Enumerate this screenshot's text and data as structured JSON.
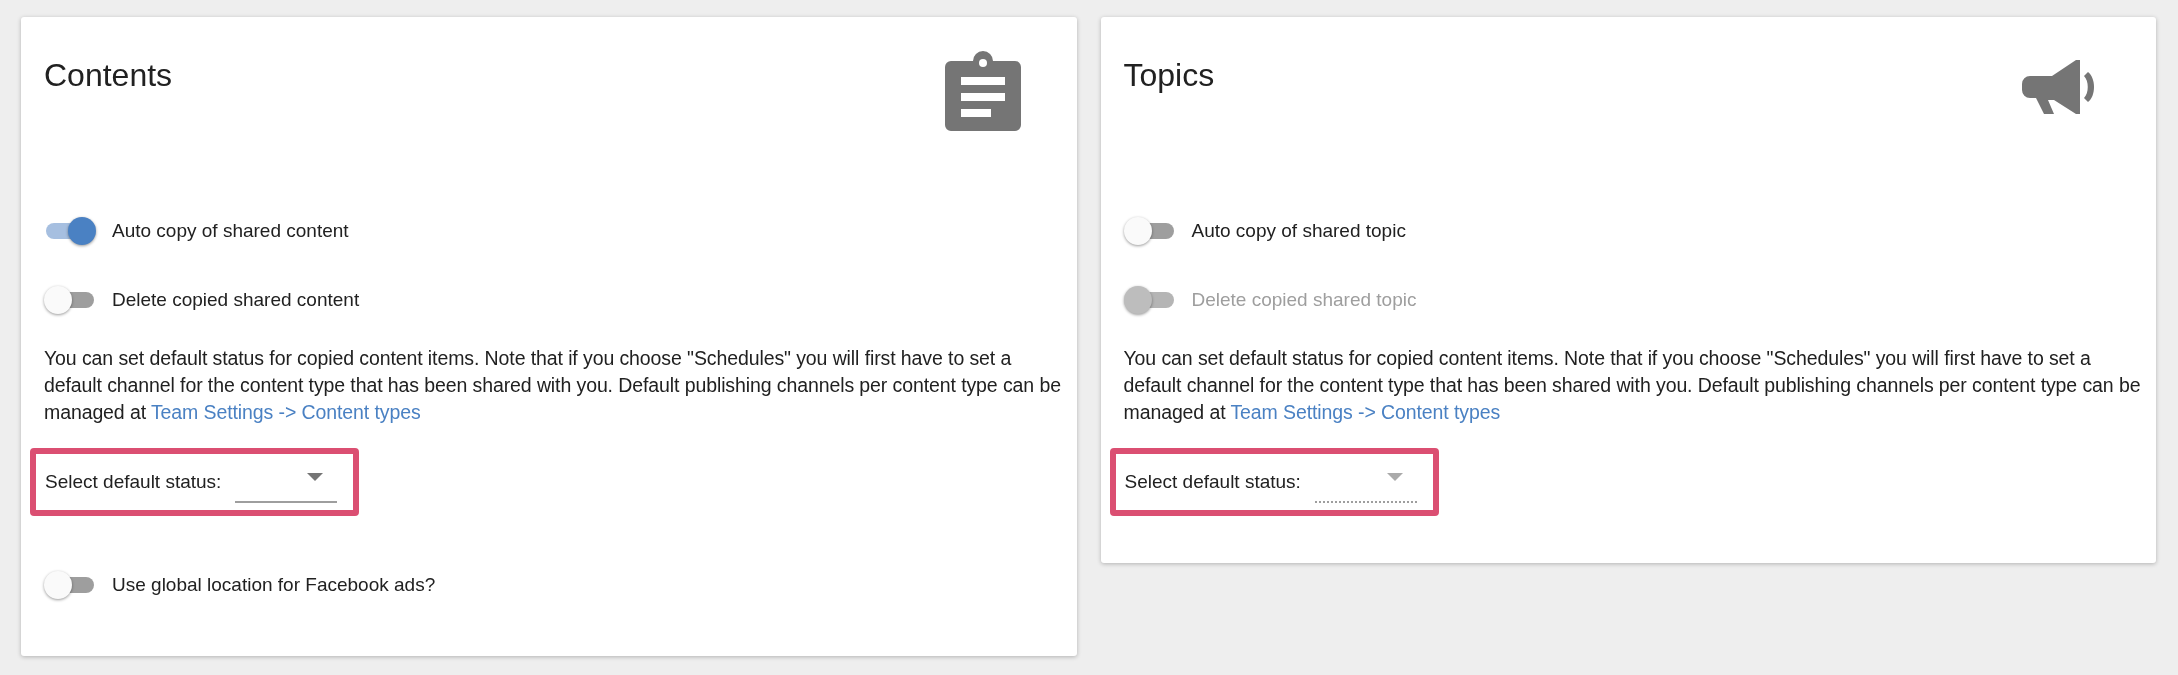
{
  "cards": [
    {
      "title": "Contents",
      "kind": "clipboard",
      "toggles": [
        {
          "label": "Auto copy of shared content",
          "on": true,
          "disabled": false
        },
        {
          "label": "Delete copied shared content",
          "on": false,
          "disabled": false
        }
      ],
      "description": "You can set default status for copied content items. Note that if you choose \"Schedules\" you will first have to set a default channel for the content type that has been shared with you. Default publishing channels per content type can be managed at",
      "link": "Team Settings -> Content types",
      "select": {
        "label": "Select default status:",
        "disabled": false,
        "highlighted": true
      },
      "extra_toggles": [
        {
          "label": "Use global location for Facebook ads?",
          "on": false,
          "disabled": false
        }
      ]
    },
    {
      "title": "Topics",
      "kind": "megaphone",
      "toggles": [
        {
          "label": "Auto copy of shared topic",
          "on": false,
          "disabled": false
        },
        {
          "label": "Delete copied shared topic",
          "on": false,
          "disabled": true
        }
      ],
      "description": "You can set default status for copied content items. Note that if you choose \"Schedules\" you will first have to set a default channel for the content type that has been shared with you. Default publishing channels per content type can be managed at",
      "link": "Team Settings -> Content types",
      "select": {
        "label": "Select default status:",
        "disabled": true,
        "highlighted": true
      }
    }
  ]
}
